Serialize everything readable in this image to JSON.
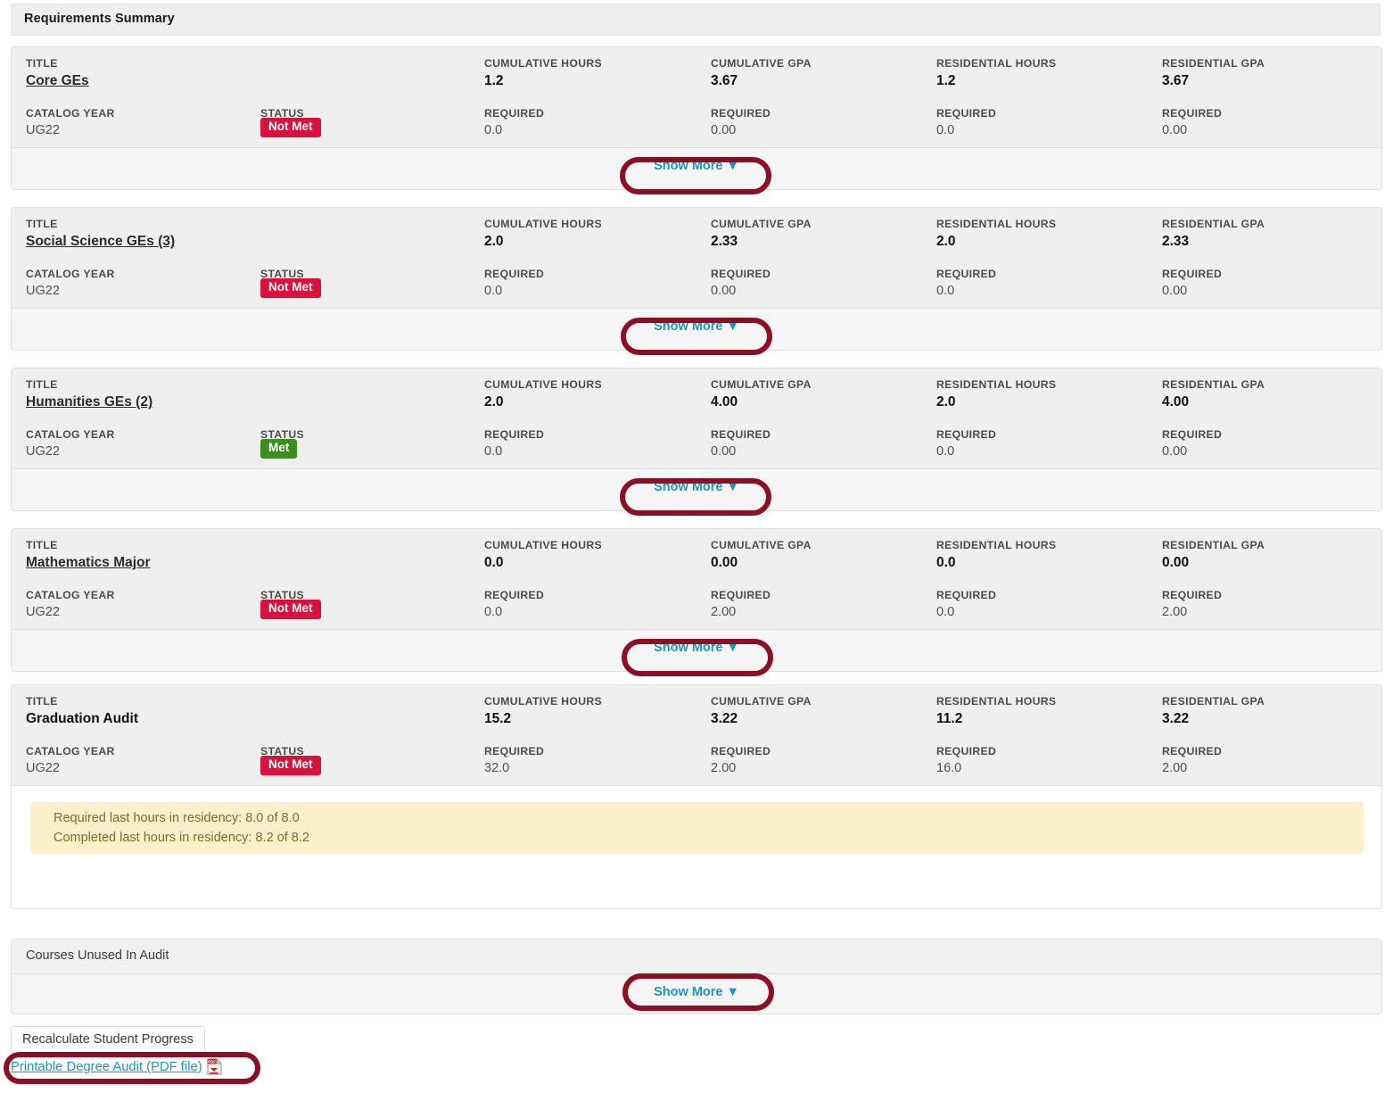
{
  "section": {
    "title": "Requirements Summary"
  },
  "columns": {
    "title": "TITLE",
    "catalog_year": "CATALOG YEAR",
    "status": "STATUS",
    "cumulative_hours": "CUMULATIVE HOURS",
    "cumulative_gpa": "CUMULATIVE GPA",
    "residential_hours": "RESIDENTIAL HOURS",
    "residential_gpa": "RESIDENTIAL GPA",
    "required": "REQUIRED"
  },
  "show_more_label": "Show More ▼",
  "colors": {
    "not_met_badge": "#d9113d",
    "met_badge": "#3c8e1e",
    "link": "#1b97bd",
    "highlight_ring": "#8c0f23",
    "alert_background": "#fcf0ca",
    "alert_text": "#7d6b32"
  },
  "requirements": [
    {
      "title": "Core GEs",
      "is_link": true,
      "catalog_year": "UG22",
      "status": "Not Met",
      "status_type": "not-met",
      "cumulative_hours": "1.2",
      "cumulative_hours_required": "0.0",
      "cumulative_gpa": "3.67",
      "cumulative_gpa_required": "0.00",
      "residential_hours": "1.2",
      "residential_hours_required": "0.0",
      "residential_gpa": "3.67",
      "residential_gpa_required": "0.00"
    },
    {
      "title": "Social Science GEs (3)",
      "is_link": true,
      "catalog_year": "UG22",
      "status": "Not Met",
      "status_type": "not-met",
      "cumulative_hours": "2.0",
      "cumulative_hours_required": "0.0",
      "cumulative_gpa": "2.33",
      "cumulative_gpa_required": "0.00",
      "residential_hours": "2.0",
      "residential_hours_required": "0.0",
      "residential_gpa": "2.33",
      "residential_gpa_required": "0.00"
    },
    {
      "title": "Humanities GEs (2)",
      "is_link": true,
      "catalog_year": "UG22",
      "status": "Met",
      "status_type": "met",
      "cumulative_hours": "2.0",
      "cumulative_hours_required": "0.0",
      "cumulative_gpa": "4.00",
      "cumulative_gpa_required": "0.00",
      "residential_hours": "2.0",
      "residential_hours_required": "0.0",
      "residential_gpa": "4.00",
      "residential_gpa_required": "0.00"
    },
    {
      "title": "Mathematics Major",
      "is_link": true,
      "catalog_year": "UG22",
      "status": "Not Met",
      "status_type": "not-met",
      "cumulative_hours": "0.0",
      "cumulative_hours_required": "0.0",
      "cumulative_gpa": "0.00",
      "cumulative_gpa_required": "2.00",
      "residential_hours": "0.0",
      "residential_hours_required": "0.0",
      "residential_gpa": "0.00",
      "residential_gpa_required": "2.00"
    }
  ],
  "graduation_audit": {
    "title": "Graduation Audit",
    "is_link": false,
    "catalog_year": "UG22",
    "status": "Not Met",
    "status_type": "not-met",
    "cumulative_hours": "15.2",
    "cumulative_hours_required": "32.0",
    "cumulative_gpa": "3.22",
    "cumulative_gpa_required": "2.00",
    "residential_hours": "11.2",
    "residential_hours_required": "16.0",
    "residential_gpa": "3.22",
    "residential_gpa_required": "2.00",
    "alert": {
      "line1": "Required last hours in residency: 8.0 of 8.0",
      "line2": "Completed last hours in residency: 8.2 of 8.2"
    }
  },
  "courses_unused": {
    "label": "Courses Unused In Audit"
  },
  "footer": {
    "recalculate_label": "Recalculate Student Progress",
    "pdf_link_label": "Printable Degree Audit (PDF file)",
    "pdf_icon_text": "PDF"
  }
}
